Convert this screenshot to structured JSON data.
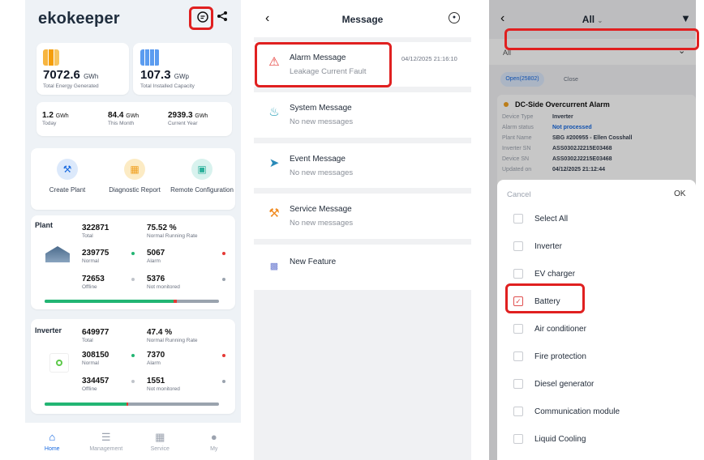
{
  "screen1": {
    "logo": "ekokeeper",
    "summary": {
      "energy_value": "7072.6",
      "energy_unit": "GWh",
      "energy_label": "Total Energy Generated",
      "capacity_value": "107.3",
      "capacity_unit": "GWp",
      "capacity_label": "Total Installed Capacity"
    },
    "periods": [
      {
        "value": "1.2",
        "unit": "GWh",
        "label": "Today"
      },
      {
        "value": "84.4",
        "unit": "GWh",
        "label": "This Month"
      },
      {
        "value": "2939.3",
        "unit": "GWh",
        "label": "Current Year"
      }
    ],
    "quick_actions": [
      {
        "label": "Create Plant",
        "icon": "wrench-icon"
      },
      {
        "label": "Diagnostic Report",
        "icon": "document-icon"
      },
      {
        "label": "Remote Configuration",
        "icon": "monitor-icon"
      }
    ],
    "plant": {
      "title": "Plant",
      "total": "322871",
      "total_label": "Total",
      "rate": "75.52 %",
      "rate_label": "Normal Running Rate",
      "normal": "239775",
      "normal_label": "Normal",
      "alarm": "5067",
      "alarm_label": "Alarm",
      "offline": "72653",
      "offline_label": "Offline",
      "not_monitored": "5376",
      "not_monitored_label": "Not monitored",
      "normal_fraction": 0.74,
      "alarm_fraction": 0.02
    },
    "inverter": {
      "title": "Inverter",
      "total": "649977",
      "total_label": "Total",
      "rate": "47.4 %",
      "rate_label": "Normal Running Rate",
      "normal": "308150",
      "normal_label": "Normal",
      "alarm": "7370",
      "alarm_label": "Alarm",
      "offline": "334457",
      "offline_label": "Offline",
      "not_monitored": "1551",
      "not_monitored_label": "Not monitored",
      "normal_fraction": 0.47,
      "alarm_fraction": 0.01
    },
    "tabs": [
      "Home",
      "Management",
      "Service",
      "My"
    ]
  },
  "screen2": {
    "title": "Message",
    "items": [
      {
        "title": "Alarm Message",
        "subtitle": "Leakage Current Fault",
        "time": "04/12/2025 21:16:10"
      },
      {
        "title": "System Message",
        "subtitle": "No new messages"
      },
      {
        "title": "Event Message",
        "subtitle": "No new messages"
      },
      {
        "title": "Service Message",
        "subtitle": "No new messages"
      },
      {
        "title": "New Feature"
      }
    ]
  },
  "screen3": {
    "title": "All",
    "filter_value": "All",
    "tabs": [
      "Open(25802)",
      "Close"
    ],
    "alarm": {
      "title": "DC-Side Overcurrent Alarm",
      "rows": [
        {
          "k": "Device Type",
          "v": "Inverter"
        },
        {
          "k": "Alarm status",
          "v": "Not processed"
        },
        {
          "k": "Plant Name",
          "v": "SBG #200955 - Ellen Cosshall"
        },
        {
          "k": "Inverter SN",
          "v": "ASS0302J2215E03468"
        },
        {
          "k": "Device SN",
          "v": "ASS0302J2215E03468"
        },
        {
          "k": "Updated on",
          "v": "04/12/2025 21:12:44"
        }
      ]
    },
    "sheet": {
      "cancel": "Cancel",
      "ok": "OK",
      "options": [
        "Select All",
        "Inverter",
        "EV charger",
        "Battery",
        "Air conditioner",
        "Fire protection",
        "Diesel generator",
        "Communication module",
        "Liquid Cooling"
      ],
      "checked_index": 3
    }
  },
  "colors": {
    "accent": "#1769e0",
    "normal": "#22b573",
    "alarm": "#e53935",
    "highlight": "#e02020"
  }
}
